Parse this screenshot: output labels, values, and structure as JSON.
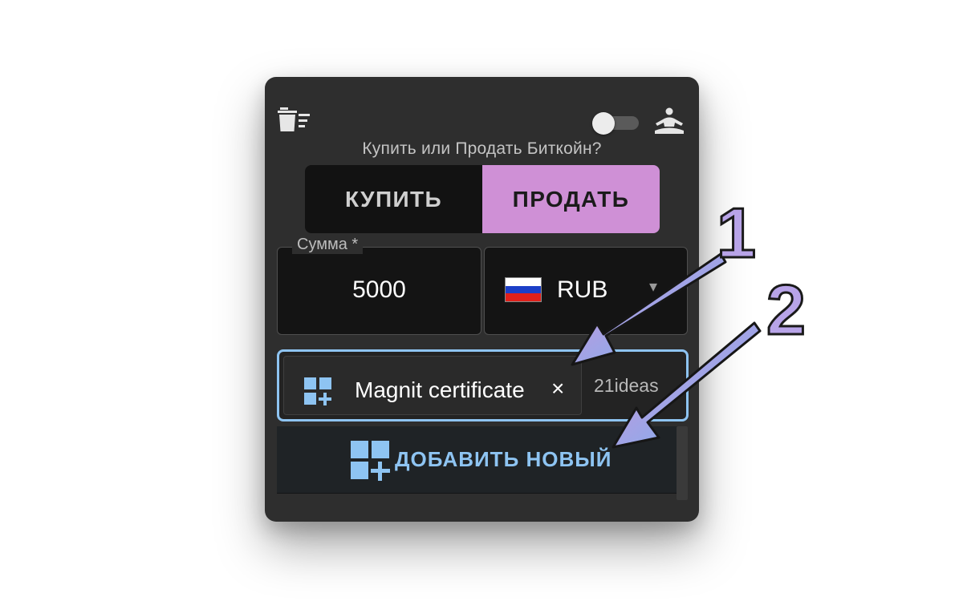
{
  "header": {
    "clear_icon": "clear-list-icon",
    "toggle_state": "off",
    "meditation_icon": "meditation-icon",
    "question": "Купить или Продать Биткойн?"
  },
  "trade_mode": {
    "buy_label": "КУПИТЬ",
    "sell_label": "ПРОДАТЬ",
    "selected": "sell",
    "selected_color": "#cf90d6"
  },
  "amount": {
    "label": "Сумма *",
    "value": "5000"
  },
  "currency": {
    "flag": "russia-flag",
    "code": "RUB"
  },
  "payment_methods": {
    "chips": [
      {
        "label": "Magnit certificate",
        "close": "×",
        "icon": "grid-plus-icon"
      }
    ],
    "overflow_text": "21ideas",
    "focus_color": "#8ec4f2"
  },
  "add_button": {
    "icon": "grid-plus-icon",
    "label": "ДОБАВИТЬ НОВЫЙ"
  },
  "annotations": {
    "arrow1_number": "1",
    "arrow2_number": "2",
    "gradient_start": "#d98fd6",
    "gradient_end": "#6ab8f5"
  }
}
